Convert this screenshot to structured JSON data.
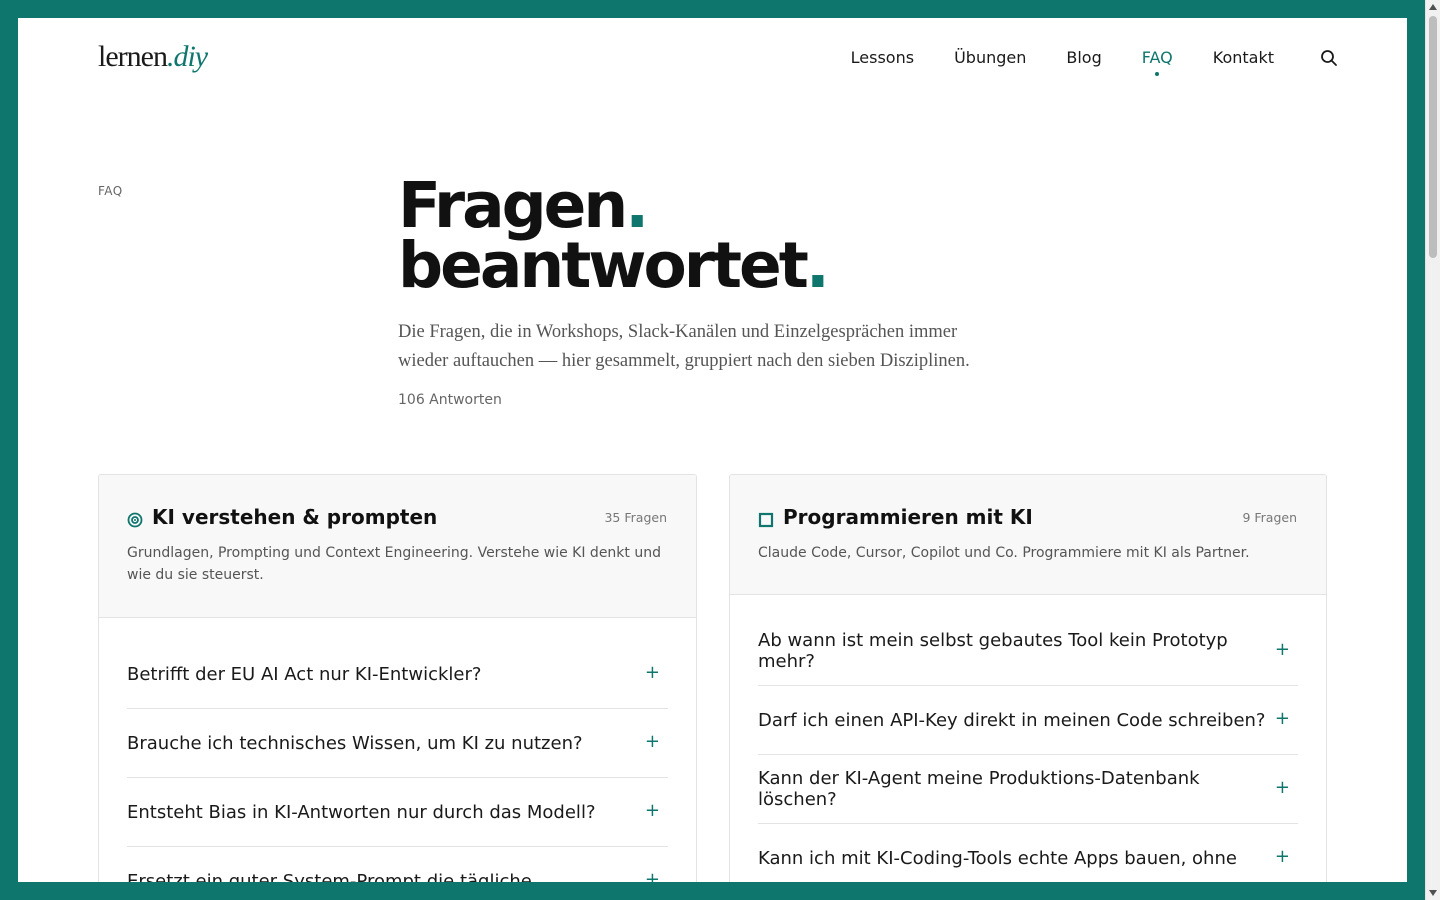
{
  "brand": {
    "name": "lernen",
    "suffix": ".diy"
  },
  "nav": {
    "items": [
      {
        "label": "Lessons"
      },
      {
        "label": "Übungen"
      },
      {
        "label": "Blog"
      },
      {
        "label": "FAQ"
      },
      {
        "label": "Kontakt"
      }
    ],
    "active": "FAQ"
  },
  "eyebrow": "FAQ",
  "hero": {
    "line1": "Fragen",
    "line2": "beantwortet",
    "period": ".",
    "description": "Die Fragen, die in Workshops, Slack-Kanälen und Einzelgesprächen immer wieder auftauchen — hier gesammelt, gruppiert nach den sieben Disziplinen.",
    "count": "106 Antworten"
  },
  "categories": [
    {
      "title": "KI verstehen & prompten",
      "icon": "eye-icon",
      "count": "35 Fragen",
      "description": "Grundlagen, Prompting und Context Engineering. Verstehe wie KI denkt und wie du sie steuerst.",
      "questions": [
        "Betrifft der EU AI Act nur KI-Entwickler?",
        "Brauche ich technisches Wissen, um KI zu nutzen?",
        "Entsteht Bias in KI-Antworten nur durch das Modell?",
        "Ersetzt ein guter System-Prompt die tägliche"
      ]
    },
    {
      "title": "Programmieren mit KI",
      "icon": "square-icon",
      "count": "9 Fragen",
      "description": "Claude Code, Cursor, Copilot und Co. Programmiere mit KI als Partner.",
      "questions": [
        "Ab wann ist mein selbst gebautes Tool kein Prototyp mehr?",
        "Darf ich einen API-Key direkt in meinen Code schreiben?",
        "Kann der KI-Agent meine Produktions-Datenbank löschen?",
        "Kann ich mit KI-Coding-Tools echte Apps bauen, ohne"
      ]
    }
  ],
  "colors": {
    "accent": "#0f766e",
    "frame": "#0f766e",
    "text": "#1a1a1a",
    "muted": "#555555"
  }
}
